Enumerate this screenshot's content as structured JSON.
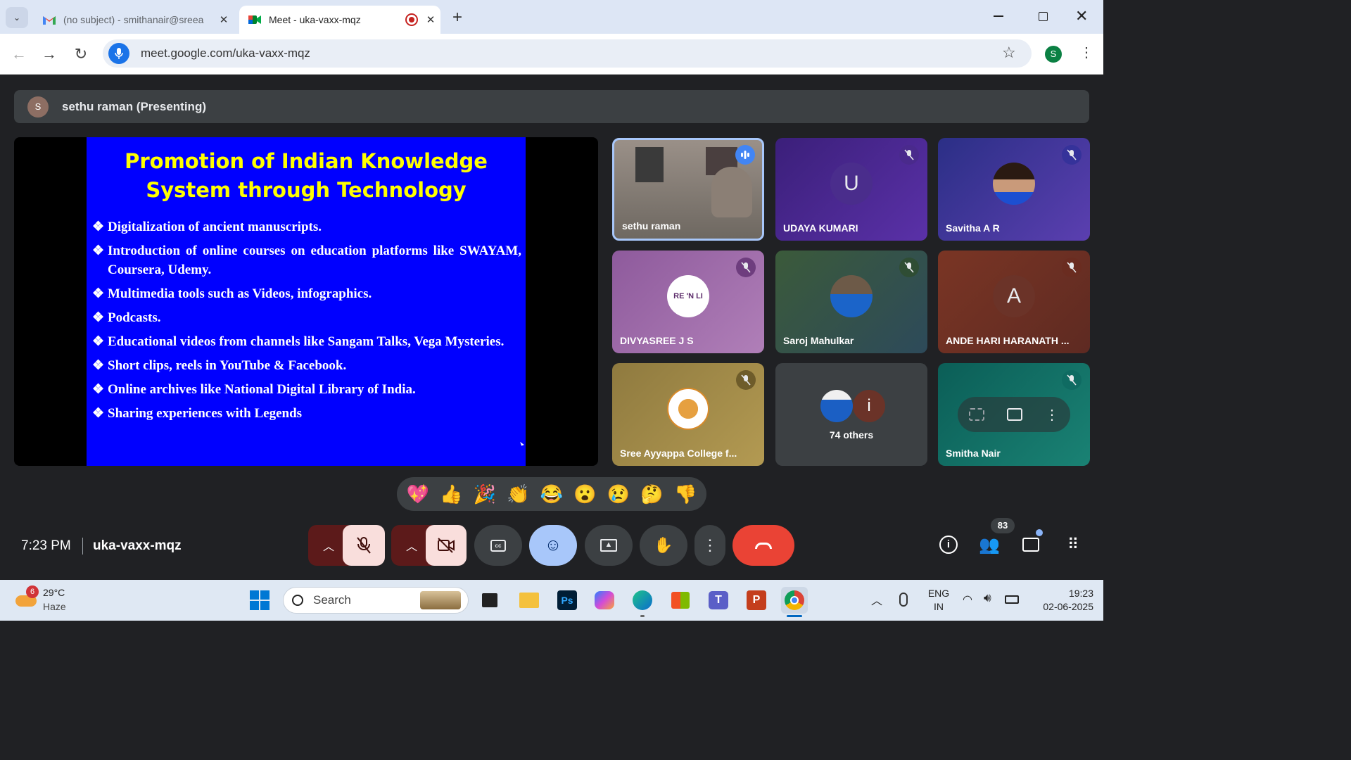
{
  "browser": {
    "tabs": [
      {
        "label": "(no subject) - smithanair@sreea",
        "icon": "gmail-icon"
      },
      {
        "label": "Meet - uka-vaxx-mqz",
        "icon": "meet-icon",
        "recording": true
      }
    ],
    "url": "meet.google.com/uka-vaxx-mqz",
    "profile_initial": "S"
  },
  "presenter_bar": {
    "avatar_initial": "S",
    "text": "sethu raman (Presenting)"
  },
  "slide": {
    "title": "Promotion of Indian Knowledge System through Technology",
    "bullet_symbol": "❖",
    "bullets": [
      "Digitalization of ancient manuscripts.",
      "Introduction of online courses on education platforms like SWAYAM, Coursera, Udemy.",
      "Multimedia tools such as Videos, infographics.",
      "Podcasts.",
      "Educational videos from channels like Sangam Talks, Vega Mysteries.",
      "Short clips, reels in YouTube & Facebook.",
      "Online archives like National Digital Library of India.",
      "Sharing experiences with Legends"
    ]
  },
  "participants": [
    {
      "name": "sethu raman",
      "speaking": true
    },
    {
      "name": "UDAYA KUMARI",
      "initial": "U",
      "muted": true
    },
    {
      "name": "Savitha A R",
      "muted": true
    },
    {
      "name": "DIVYASREE J S",
      "avatar_text": "RE 'N LI",
      "muted": true
    },
    {
      "name": "Saroj Mahulkar",
      "muted": true
    },
    {
      "name": "ANDE HARI HARANATH ...",
      "initial": "A",
      "muted": true
    },
    {
      "name": "Sree Ayyappa College f...",
      "muted": true
    },
    {
      "name": "74 others",
      "initial": "i"
    },
    {
      "name": "Smitha Nair",
      "muted": true
    }
  ],
  "reactions": [
    "💖",
    "👍",
    "🎉",
    "👏",
    "😂",
    "😮",
    "😢",
    "🤔",
    "👎"
  ],
  "controls": {
    "time": "7:23 PM",
    "meeting_code": "uka-vaxx-mqz",
    "people_count": "83"
  },
  "taskbar": {
    "weather_badge": "6",
    "temperature": "29°C",
    "condition": "Haze",
    "search_placeholder": "Search",
    "lang_top": "ENG",
    "lang_bottom": "IN",
    "time": "19:23",
    "date": "02-06-2025"
  },
  "colors": {
    "meet_bg": "#202124",
    "slide_bg": "#0000ff",
    "slide_title": "#ffff00",
    "end_call": "#ea4335",
    "reaction_active": "#a8c7fa"
  }
}
